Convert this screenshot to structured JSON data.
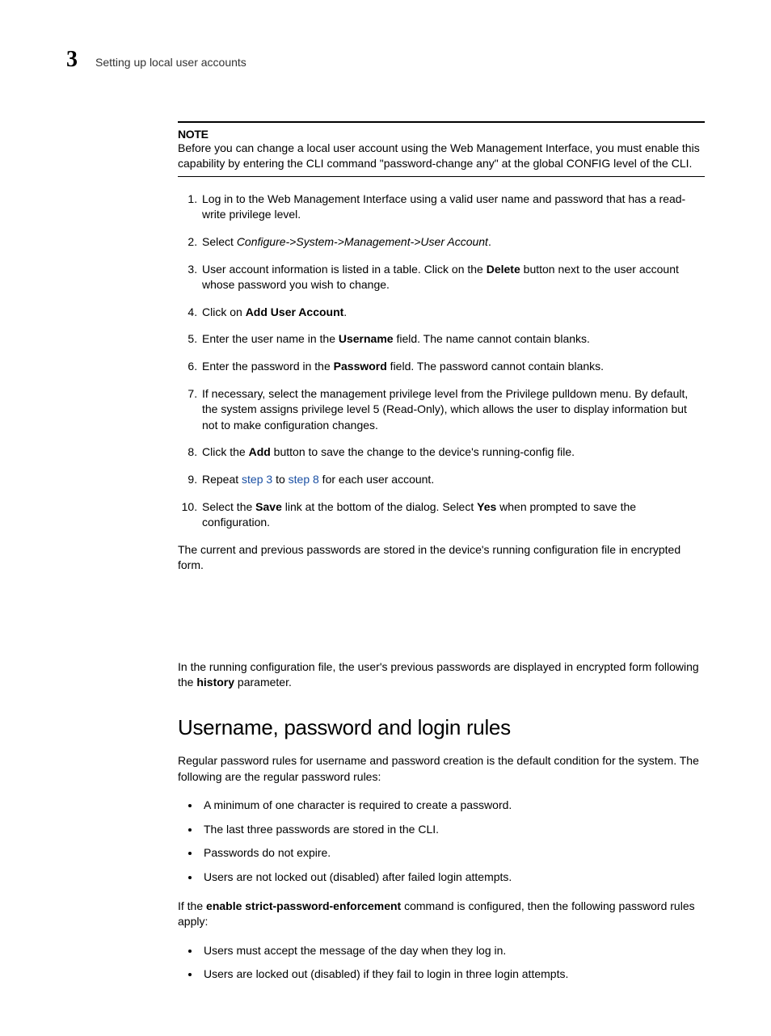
{
  "header": {
    "chapter_number": "3",
    "chapter_title": "Setting up local user accounts"
  },
  "note": {
    "label": "NOTE",
    "body": "Before you can change a local user account using the Web Management Interface, you must enable this capability by entering the CLI command \"password-change any\" at the global CONFIG level of the CLI."
  },
  "steps": {
    "s1": "Log in to the Web Management Interface using a valid user name and password that has a read-write privilege level.",
    "s2_pre": "Select ",
    "s2_italic": "Configure->System->Management->User Account",
    "s2_post": ".",
    "s3_pre": "User account information is listed in a table. Click on the ",
    "s3_bold": "Delete",
    "s3_post": " button next to the user account whose password you wish to change.",
    "s4_pre": "Click on ",
    "s4_bold": "Add User Account",
    "s4_post": ".",
    "s5_pre": "Enter the user name in the ",
    "s5_bold": "Username",
    "s5_post": " field.  The name cannot contain blanks.",
    "s6_pre": "Enter the password in the ",
    "s6_bold": "Password",
    "s6_post": " field.  The password cannot contain blanks.",
    "s7": "If necessary, select the management privilege level from the Privilege pulldown menu.  By default, the system assigns privilege level 5 (Read-Only), which allows the user to display information but not to make configuration changes.",
    "s8_pre": "Click the ",
    "s8_bold": "Add",
    "s8_post": " button to save the change to the device's running-config file.",
    "s9_pre": "Repeat ",
    "s9_link1": "step 3",
    "s9_mid": " to ",
    "s9_link2": "step 8",
    "s9_post": " for each user account.",
    "s10_pre": "Select the ",
    "s10_bold1": "Save",
    "s10_mid": " link at the bottom of the dialog.  Select ",
    "s10_bold2": "Yes",
    "s10_post": " when prompted to save the configuration."
  },
  "para1": "The current and previous passwords are stored in the device's running configuration file in encrypted form.",
  "para2_pre": "In the running configuration file, the user's previous passwords are displayed in encrypted form following the ",
  "para2_bold": "history",
  "para2_post": " parameter.",
  "section_heading": "Username, password and login rules",
  "para3": "Regular password rules for username and password creation is the default condition for the system. The following are the regular password rules:",
  "bullets1": {
    "b1": "A minimum of one character is required to create a password.",
    "b2": "The last three passwords are stored in the CLI.",
    "b3": "Passwords do not expire.",
    "b4": "Users are not locked out (disabled) after failed login attempts."
  },
  "para4_pre": "If the ",
  "para4_bold": "enable strict-password-enforcement",
  "para4_post": " command is configured, then the following password rules apply:",
  "bullets2": {
    "b1": "Users must accept the message of the day when they log in.",
    "b2": "Users are locked out (disabled) if they fail to login in three login attempts."
  }
}
